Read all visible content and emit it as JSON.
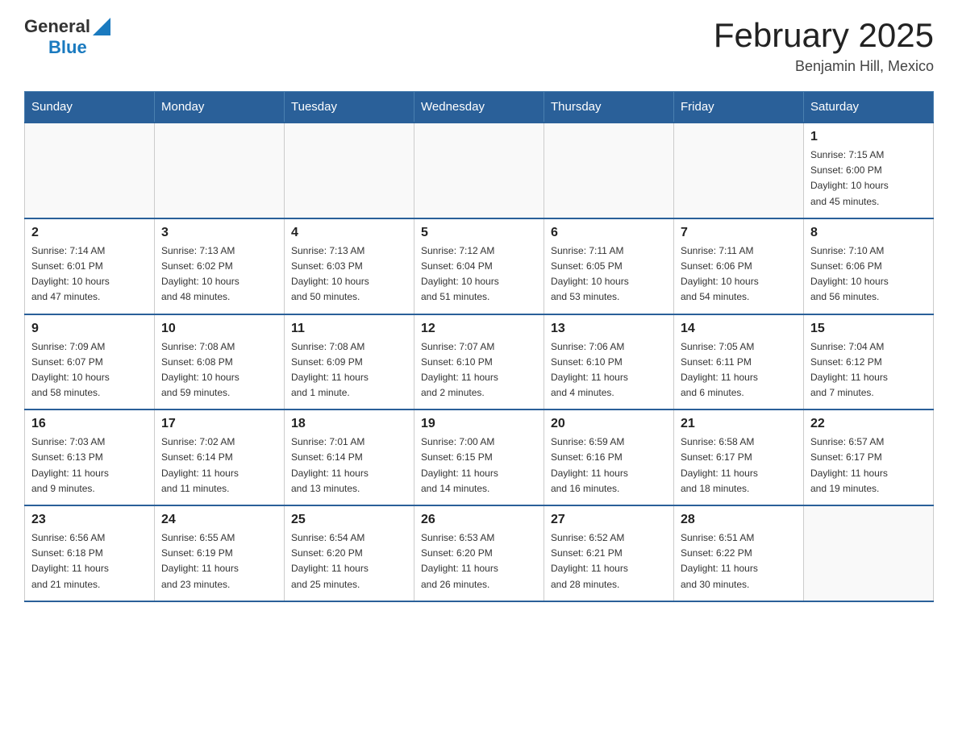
{
  "header": {
    "logo": {
      "general": "General",
      "blue": "Blue"
    },
    "title": "February 2025",
    "location": "Benjamin Hill, Mexico"
  },
  "days_of_week": [
    "Sunday",
    "Monday",
    "Tuesday",
    "Wednesday",
    "Thursday",
    "Friday",
    "Saturday"
  ],
  "weeks": [
    [
      {
        "day": "",
        "info": ""
      },
      {
        "day": "",
        "info": ""
      },
      {
        "day": "",
        "info": ""
      },
      {
        "day": "",
        "info": ""
      },
      {
        "day": "",
        "info": ""
      },
      {
        "day": "",
        "info": ""
      },
      {
        "day": "1",
        "info": "Sunrise: 7:15 AM\nSunset: 6:00 PM\nDaylight: 10 hours\nand 45 minutes."
      }
    ],
    [
      {
        "day": "2",
        "info": "Sunrise: 7:14 AM\nSunset: 6:01 PM\nDaylight: 10 hours\nand 47 minutes."
      },
      {
        "day": "3",
        "info": "Sunrise: 7:13 AM\nSunset: 6:02 PM\nDaylight: 10 hours\nand 48 minutes."
      },
      {
        "day": "4",
        "info": "Sunrise: 7:13 AM\nSunset: 6:03 PM\nDaylight: 10 hours\nand 50 minutes."
      },
      {
        "day": "5",
        "info": "Sunrise: 7:12 AM\nSunset: 6:04 PM\nDaylight: 10 hours\nand 51 minutes."
      },
      {
        "day": "6",
        "info": "Sunrise: 7:11 AM\nSunset: 6:05 PM\nDaylight: 10 hours\nand 53 minutes."
      },
      {
        "day": "7",
        "info": "Sunrise: 7:11 AM\nSunset: 6:06 PM\nDaylight: 10 hours\nand 54 minutes."
      },
      {
        "day": "8",
        "info": "Sunrise: 7:10 AM\nSunset: 6:06 PM\nDaylight: 10 hours\nand 56 minutes."
      }
    ],
    [
      {
        "day": "9",
        "info": "Sunrise: 7:09 AM\nSunset: 6:07 PM\nDaylight: 10 hours\nand 58 minutes."
      },
      {
        "day": "10",
        "info": "Sunrise: 7:08 AM\nSunset: 6:08 PM\nDaylight: 10 hours\nand 59 minutes."
      },
      {
        "day": "11",
        "info": "Sunrise: 7:08 AM\nSunset: 6:09 PM\nDaylight: 11 hours\nand 1 minute."
      },
      {
        "day": "12",
        "info": "Sunrise: 7:07 AM\nSunset: 6:10 PM\nDaylight: 11 hours\nand 2 minutes."
      },
      {
        "day": "13",
        "info": "Sunrise: 7:06 AM\nSunset: 6:10 PM\nDaylight: 11 hours\nand 4 minutes."
      },
      {
        "day": "14",
        "info": "Sunrise: 7:05 AM\nSunset: 6:11 PM\nDaylight: 11 hours\nand 6 minutes."
      },
      {
        "day": "15",
        "info": "Sunrise: 7:04 AM\nSunset: 6:12 PM\nDaylight: 11 hours\nand 7 minutes."
      }
    ],
    [
      {
        "day": "16",
        "info": "Sunrise: 7:03 AM\nSunset: 6:13 PM\nDaylight: 11 hours\nand 9 minutes."
      },
      {
        "day": "17",
        "info": "Sunrise: 7:02 AM\nSunset: 6:14 PM\nDaylight: 11 hours\nand 11 minutes."
      },
      {
        "day": "18",
        "info": "Sunrise: 7:01 AM\nSunset: 6:14 PM\nDaylight: 11 hours\nand 13 minutes."
      },
      {
        "day": "19",
        "info": "Sunrise: 7:00 AM\nSunset: 6:15 PM\nDaylight: 11 hours\nand 14 minutes."
      },
      {
        "day": "20",
        "info": "Sunrise: 6:59 AM\nSunset: 6:16 PM\nDaylight: 11 hours\nand 16 minutes."
      },
      {
        "day": "21",
        "info": "Sunrise: 6:58 AM\nSunset: 6:17 PM\nDaylight: 11 hours\nand 18 minutes."
      },
      {
        "day": "22",
        "info": "Sunrise: 6:57 AM\nSunset: 6:17 PM\nDaylight: 11 hours\nand 19 minutes."
      }
    ],
    [
      {
        "day": "23",
        "info": "Sunrise: 6:56 AM\nSunset: 6:18 PM\nDaylight: 11 hours\nand 21 minutes."
      },
      {
        "day": "24",
        "info": "Sunrise: 6:55 AM\nSunset: 6:19 PM\nDaylight: 11 hours\nand 23 minutes."
      },
      {
        "day": "25",
        "info": "Sunrise: 6:54 AM\nSunset: 6:20 PM\nDaylight: 11 hours\nand 25 minutes."
      },
      {
        "day": "26",
        "info": "Sunrise: 6:53 AM\nSunset: 6:20 PM\nDaylight: 11 hours\nand 26 minutes."
      },
      {
        "day": "27",
        "info": "Sunrise: 6:52 AM\nSunset: 6:21 PM\nDaylight: 11 hours\nand 28 minutes."
      },
      {
        "day": "28",
        "info": "Sunrise: 6:51 AM\nSunset: 6:22 PM\nDaylight: 11 hours\nand 30 minutes."
      },
      {
        "day": "",
        "info": ""
      }
    ]
  ]
}
